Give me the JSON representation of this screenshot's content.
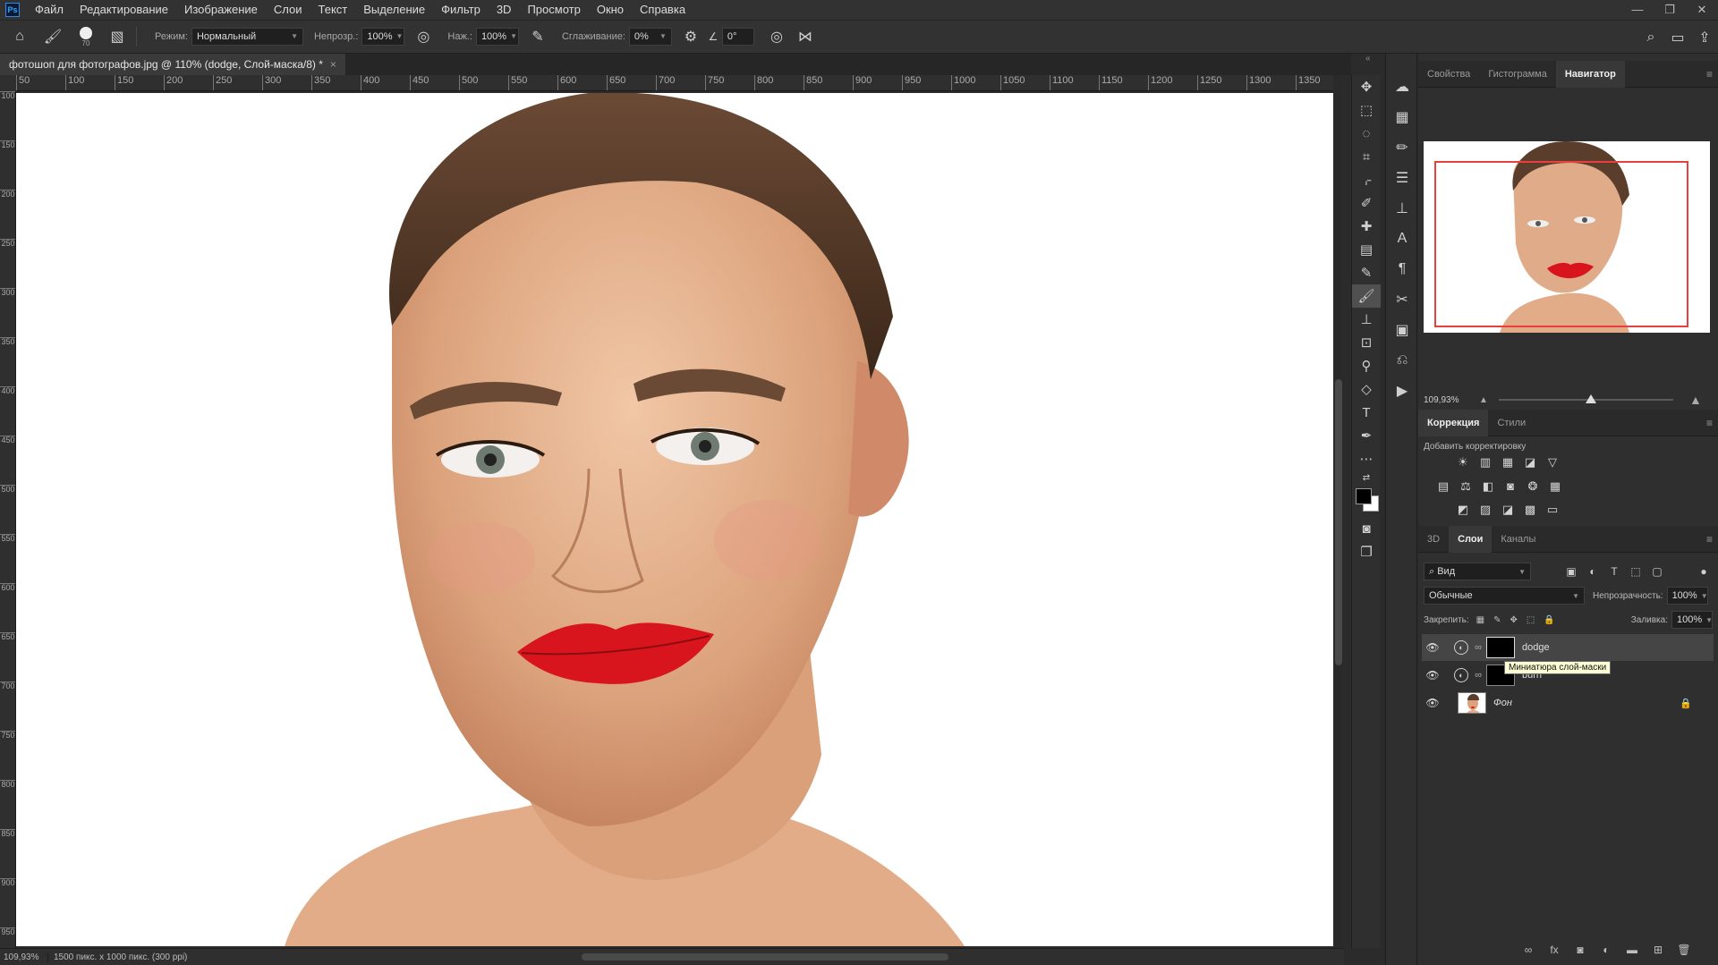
{
  "menu": {
    "app_logo": "Ps",
    "items": [
      "Файл",
      "Редактирование",
      "Изображение",
      "Слои",
      "Текст",
      "Выделение",
      "Фильтр",
      "3D",
      "Просмотр",
      "Окно",
      "Справка"
    ]
  },
  "window_controls": {
    "minimize": "—",
    "restore": "❐",
    "close": "✕"
  },
  "options": {
    "brush_size": "70",
    "mode_label": "Режим:",
    "mode_value": "Нормальный",
    "opacity_label": "Непрозр.:",
    "opacity_value": "100%",
    "flow_label": "Наж.:",
    "flow_value": "100%",
    "smoothing_label": "Сглаживание:",
    "smoothing_value": "0%",
    "angle_value": "0°"
  },
  "document": {
    "tab_title": "фотошоп для фотографов.jpg @ 110% (dodge, Слой-маска/8) *",
    "close": "×"
  },
  "ruler_h": [
    "50",
    "100",
    "150",
    "200",
    "250",
    "300",
    "350",
    "400",
    "450",
    "500",
    "550",
    "600",
    "650",
    "700",
    "750",
    "800",
    "850",
    "900",
    "950",
    "1000",
    "1050",
    "1100",
    "1150",
    "1200",
    "1250",
    "1300",
    "1350"
  ],
  "ruler_v": [
    "100",
    "150",
    "200",
    "250",
    "300",
    "350",
    "400",
    "450",
    "500",
    "550",
    "600",
    "650",
    "700",
    "750",
    "800",
    "850",
    "900",
    "950"
  ],
  "status": {
    "zoom": "109,93%",
    "info": "1500 пикс. x 1000 пикс. (300 ppi)"
  },
  "panels": {
    "top_tabs": [
      "Свойства",
      "Гистограмма",
      "Навигатор"
    ],
    "navigator_zoom": "109,93%",
    "navigator_slider_fraction": 0.5,
    "correction_tabs": [
      "Коррекция",
      "Стили"
    ],
    "add_adjustment": "Добавить корректировку",
    "layers_tabs": [
      "3D",
      "Слои",
      "Каналы"
    ],
    "filter_kind": "Вид",
    "blend_mode": "Обычные",
    "opacity_label": "Непрозрачность:",
    "opacity_value": "100%",
    "lock_label": "Закрепить:",
    "fill_label": "Заливка:",
    "fill_value": "100%",
    "layers": [
      {
        "name": "dodge",
        "selected": true
      },
      {
        "name": "burn",
        "selected": false
      },
      {
        "name": "Фон",
        "selected": false
      }
    ],
    "tooltip": "Миниатюра слой-маски"
  },
  "colors": {
    "accent": "#31a8ff",
    "nav_frame": "#e8403f",
    "lips": "#d8151d"
  }
}
